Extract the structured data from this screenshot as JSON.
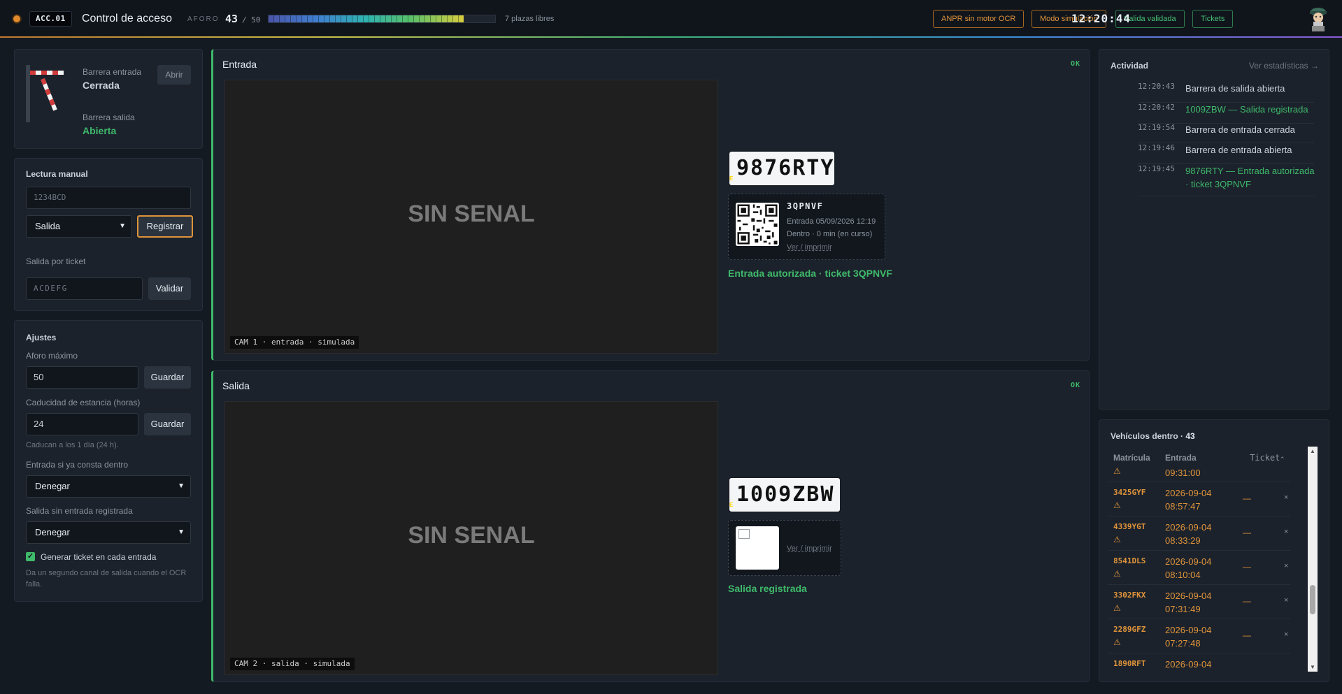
{
  "header": {
    "badge": "ACC.01",
    "title": "Control de acceso",
    "aforo_label": "AFORO",
    "aforo_count": "43",
    "aforo_max": "/ 50",
    "occupancy_fraction": 0.86,
    "plazas_libres": "7 plazas libres",
    "buttons": {
      "anpr": "ANPR sin motor OCR",
      "simulacion": "Modo simulación",
      "salida_validada": "Salida validada",
      "tickets": "Tickets"
    },
    "clock": "12:20:44"
  },
  "barriers": {
    "entrada_label": "Barrera entrada",
    "entrada_state": "Cerrada",
    "abrir_label": "Abrir",
    "salida_label": "Barrera salida",
    "salida_state": "Abierta"
  },
  "manual": {
    "title": "Lectura manual",
    "plate_placeholder": "1234BCD",
    "direction_value": "Salida",
    "register_label": "Registrar",
    "ticket_exit_label": "Salida por ticket",
    "ticket_placeholder": "ACDEFG",
    "validate_label": "Validar"
  },
  "settings": {
    "title": "Ajustes",
    "aforo_label": "Aforo máximo",
    "aforo_value": "50",
    "save_label": "Guardar",
    "caducidad_label": "Caducidad de estancia (horas)",
    "caducidad_value": "24",
    "caducidad_hint": "Caducan a los 1 día (24 h).",
    "entrada_dentro_label": "Entrada si ya consta dentro",
    "entrada_dentro_value": "Denegar",
    "salida_sin_label": "Salida sin entrada registrada",
    "salida_sin_value": "Denegar",
    "generar_ticket_label": "Generar ticket en cada entrada",
    "generar_ticket_checked": true,
    "generar_ticket_hint": "Da un segundo canal de salida cuando el OCR falla."
  },
  "entrada": {
    "title": "Entrada",
    "status": "OK",
    "no_signal": "SIN SENAL",
    "caption": "CAM 1 · entrada · simulada",
    "plate_country": "E",
    "plate": "9876RTY",
    "ticket_code": "3QPNVF",
    "ticket_entry": "Entrada 05/09/2026 12:19",
    "ticket_inside": "Dentro · 0 min (en curso)",
    "ticket_link": "Ver / imprimir",
    "message": "Entrada autorizada · ticket 3QPNVF"
  },
  "salida": {
    "title": "Salida",
    "status": "OK",
    "no_signal": "SIN SENAL",
    "caption": "CAM 2 · salida · simulada",
    "plate_country": "E",
    "plate": "1009ZBW",
    "ticket_link": "Ver / imprimir",
    "message": "Salida registrada"
  },
  "activity": {
    "title": "Actividad",
    "stats_link": "Ver estadísticas →",
    "items": [
      {
        "time": "12:20:43",
        "text": "Barrera de salida abierta"
      },
      {
        "time": "12:20:42",
        "text": "1009ZBW — Salida registrada"
      },
      {
        "time": "12:19:54",
        "text": "Barrera de entrada cerrada"
      },
      {
        "time": "12:19:46",
        "text": "Barrera de entrada abierta"
      },
      {
        "time": "12:19:45",
        "text": "9876RTY — Entrada autorizada · ticket 3QPNVF"
      }
    ]
  },
  "vehicles": {
    "title": "Vehículos dentro ·",
    "count": "43",
    "columns": [
      "Matrícula",
      "Entrada",
      "Ticket"
    ],
    "partial_time": "09:31:00",
    "warn_icon": "⚠",
    "rows": [
      {
        "plate": "3425GYF",
        "date": "2026-09-04",
        "time": "08:57:47",
        "ticket": "—"
      },
      {
        "plate": "4339YGT",
        "date": "2026-09-04",
        "time": "08:33:29",
        "ticket": "—"
      },
      {
        "plate": "8541DLS",
        "date": "2026-09-04",
        "time": "08:10:04",
        "ticket": "—"
      },
      {
        "plate": "3302FKX",
        "date": "2026-09-04",
        "time": "07:31:49",
        "ticket": "—"
      },
      {
        "plate": "2289GFZ",
        "date": "2026-09-04",
        "time": "07:27:48",
        "ticket": "—"
      },
      {
        "plate": "1890RFT",
        "date": "2026-09-04",
        "time": "",
        "ticket": ""
      }
    ]
  }
}
